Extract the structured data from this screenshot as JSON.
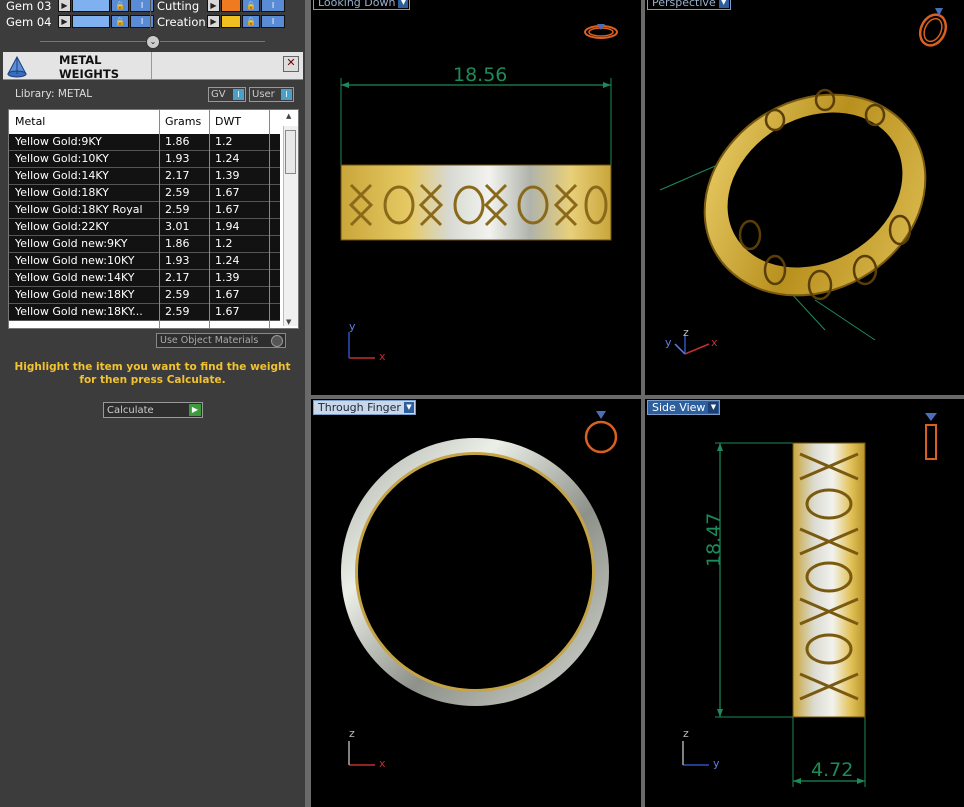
{
  "layers": {
    "left": [
      {
        "name": "Gem 03",
        "color": "#7fb0f0"
      },
      {
        "name": "Gem 04",
        "color": "#7fb0f0"
      }
    ],
    "right": [
      {
        "name": "Cutting",
        "color": "#f07a20"
      },
      {
        "name": "Creation",
        "color": "#f0c020"
      }
    ]
  },
  "panel": {
    "title": "METAL WEIGHTS",
    "close_label": "✕",
    "library_label": "Library: METAL",
    "gv_label": "GV",
    "user_label": "User",
    "columns": [
      "Metal",
      "Grams",
      "DWT"
    ],
    "rows": [
      {
        "metal": "Yellow Gold:9KY",
        "grams": "1.86",
        "dwt": "1.2"
      },
      {
        "metal": "Yellow Gold:10KY",
        "grams": "1.93",
        "dwt": "1.24"
      },
      {
        "metal": "Yellow Gold:14KY",
        "grams": "2.17",
        "dwt": "1.39"
      },
      {
        "metal": "Yellow Gold:18KY",
        "grams": "2.59",
        "dwt": "1.67"
      },
      {
        "metal": "Yellow Gold:18KY Royal",
        "grams": "2.59",
        "dwt": "1.67"
      },
      {
        "metal": "Yellow Gold:22KY",
        "grams": "3.01",
        "dwt": "1.94"
      },
      {
        "metal": "Yellow Gold new:9KY",
        "grams": "1.86",
        "dwt": "1.2"
      },
      {
        "metal": "Yellow Gold new:10KY",
        "grams": "1.93",
        "dwt": "1.24"
      },
      {
        "metal": "Yellow Gold new:14KY",
        "grams": "2.17",
        "dwt": "1.39"
      },
      {
        "metal": "Yellow Gold new:18KY",
        "grams": "2.59",
        "dwt": "1.67"
      },
      {
        "metal": "Yellow Gold new:18KY...",
        "grams": "2.59",
        "dwt": "1.67"
      }
    ],
    "use_object_materials": "Use Object Materials",
    "hint": "Highlight the item you want to find the weight for then press Calculate.",
    "calculate_label": "Calculate"
  },
  "viewports": {
    "top_left": {
      "label": "Looking Down",
      "dimension": "18.56"
    },
    "top_right": {
      "label": "Perspective"
    },
    "bottom_left": {
      "label": "Through Finger"
    },
    "bottom_right": {
      "label": "Side View",
      "dimension_vertical": "18.47",
      "dimension_horizontal": "4.72"
    }
  },
  "axes": {
    "x": "x",
    "y": "y",
    "z": "z"
  },
  "colors": {
    "accent_blue": "#5a8cd6",
    "dimension_green": "#1d8a5a",
    "hint_yellow": "#f2c230",
    "gold": "#d4b04a",
    "silver": "#c8ccc4"
  }
}
